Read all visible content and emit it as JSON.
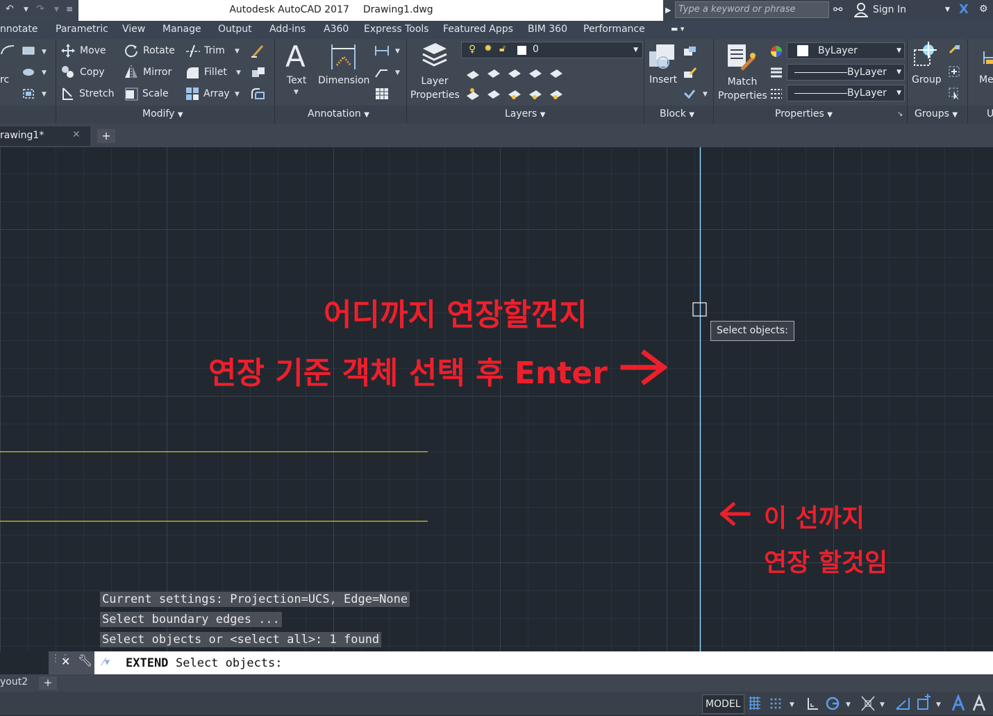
{
  "titlebar": {
    "app_title": "Autodesk AutoCAD 2017",
    "file_name": "Drawing1.dwg",
    "search_placeholder": "Type a keyword or phrase",
    "sign_in": "Sign In"
  },
  "menu_tabs": [
    "nnotate",
    "Parametric",
    "View",
    "Manage",
    "Output",
    "Add-ins",
    "A360",
    "Express Tools",
    "Featured Apps",
    "BIM 360",
    "Performance"
  ],
  "ribbon": {
    "draw_partial": "rc",
    "modify": {
      "move": "Move",
      "copy": "Copy",
      "stretch": "Stretch",
      "rotate": "Rotate",
      "mirror": "Mirror",
      "scale": "Scale",
      "trim": "Trim",
      "fillet": "Fillet",
      "array": "Array",
      "panel": "Modify"
    },
    "annotation": {
      "text": "Text",
      "dimension": "Dimension",
      "panel": "Annotation"
    },
    "layers": {
      "layer_properties_1": "Layer",
      "layer_properties_2": "Properties",
      "current_layer": "0",
      "panel": "Layers"
    },
    "block": {
      "insert": "Insert",
      "panel": "Block"
    },
    "properties": {
      "match_1": "Match",
      "match_2": "Properties",
      "color": "ByLayer",
      "linetype": "ByLayer",
      "lineweight": "ByLayer",
      "panel": "Properties"
    },
    "groups": {
      "group": "Group",
      "panel": "Groups"
    },
    "partial_me": "Me",
    "partial_u": "U"
  },
  "file_tab": {
    "name": "rawing1*"
  },
  "canvas": {
    "tooltip": "Select objects:",
    "annotation_1": "어디까지 연장할껀지",
    "annotation_2": "연장 기준 객체 선택 후 Enter",
    "annotation_3": "이 선까지",
    "annotation_4": "연장 할것임"
  },
  "command_history": [
    "Current settings: Projection=UCS, Edge=None",
    "Select boundary edges ...",
    "Select objects or <select all>: 1 found"
  ],
  "command_line": {
    "command": "EXTEND",
    "prompt": "Select objects:"
  },
  "layout_tab": "yout2",
  "status": {
    "model": "MODEL"
  },
  "colors": {
    "annotation_red": "#ee1f2b",
    "boundary_line": "#8fd0ff",
    "extend_lines": "#c8c832",
    "canvas_bg": "#212830"
  }
}
